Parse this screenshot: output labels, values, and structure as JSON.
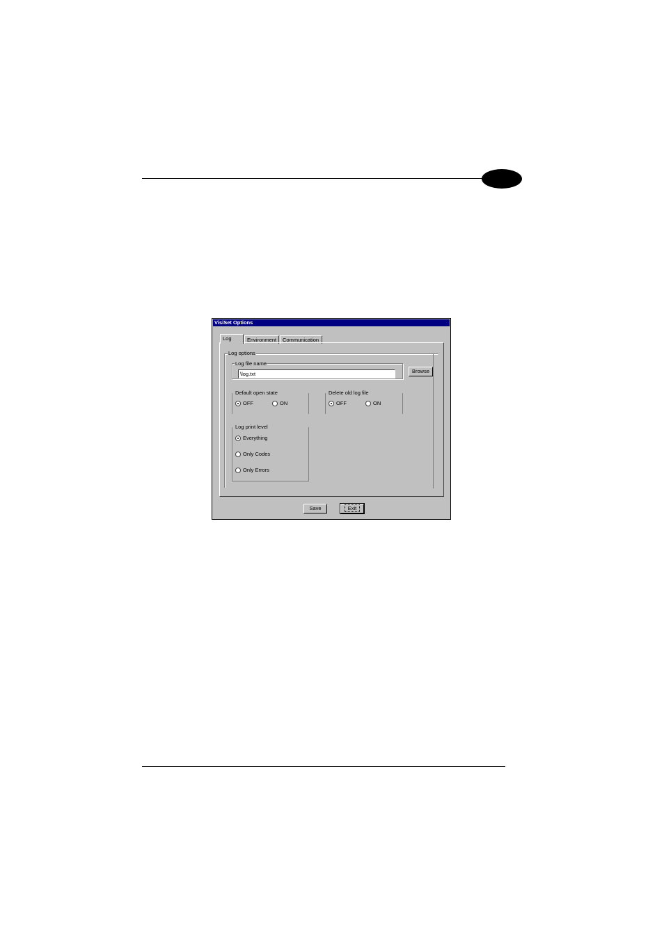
{
  "window": {
    "title": "VisiSet Options"
  },
  "tabs": [
    {
      "label": "Log",
      "active": true
    },
    {
      "label": "Environment",
      "active": false
    },
    {
      "label": "Communication",
      "active": false
    }
  ],
  "log_options": {
    "legend": "Log options",
    "file_name": {
      "legend": "Log file name",
      "value": "\\log.txt",
      "browse_label": "Browse"
    },
    "default_open_state": {
      "legend": "Default open state",
      "options": [
        "OFF",
        "ON"
      ],
      "selected": "OFF"
    },
    "delete_old_log_file": {
      "legend": "Delete old log file",
      "options": [
        "OFF",
        "ON"
      ],
      "selected": "OFF"
    },
    "log_print_level": {
      "legend": "Log print level",
      "options": [
        "Everything",
        "Only Codes",
        "Only Errors"
      ],
      "selected": "Everything"
    }
  },
  "buttons": {
    "save": "Save",
    "exit": "Exit"
  }
}
